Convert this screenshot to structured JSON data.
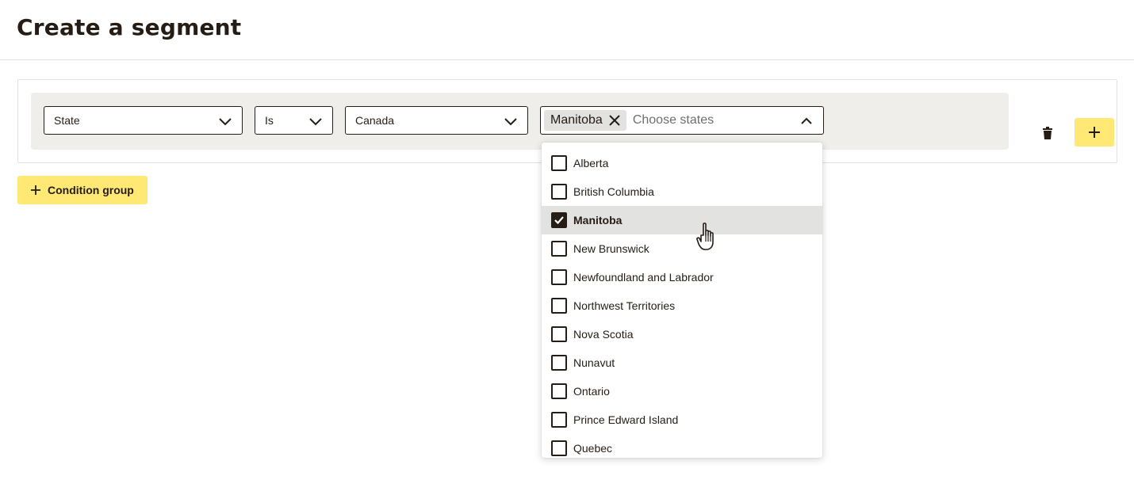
{
  "page": {
    "title": "Create a segment"
  },
  "condition": {
    "field_value": "State",
    "operator_value": "Is",
    "country_value": "Canada",
    "selected_chip": "Manitoba",
    "states_placeholder": "Choose states"
  },
  "actions": {
    "condition_group_label": "Condition group"
  },
  "dropdown": {
    "options": [
      {
        "label": "Alberta",
        "checked": false
      },
      {
        "label": "British Columbia",
        "checked": false
      },
      {
        "label": "Manitoba",
        "checked": true
      },
      {
        "label": "New Brunswick",
        "checked": false
      },
      {
        "label": "Newfoundland and Labrador",
        "checked": false
      },
      {
        "label": "Northwest Territories",
        "checked": false
      },
      {
        "label": "Nova Scotia",
        "checked": false
      },
      {
        "label": "Nunavut",
        "checked": false
      },
      {
        "label": "Ontario",
        "checked": false
      },
      {
        "label": "Prince Edward Island",
        "checked": false
      },
      {
        "label": "Quebec",
        "checked": false
      }
    ]
  },
  "colors": {
    "accent": "#ffe874",
    "text": "#241c15",
    "row_bg": "#efeeea",
    "selected_bg": "#e2e2e0"
  },
  "icons": {
    "chevron": "chevron-down-icon",
    "chevron_open": "chevron-up-icon",
    "remove": "close-icon",
    "delete": "trash-icon",
    "add": "plus-icon",
    "check": "checkmark-icon",
    "cursor": "hand-pointer-icon"
  }
}
